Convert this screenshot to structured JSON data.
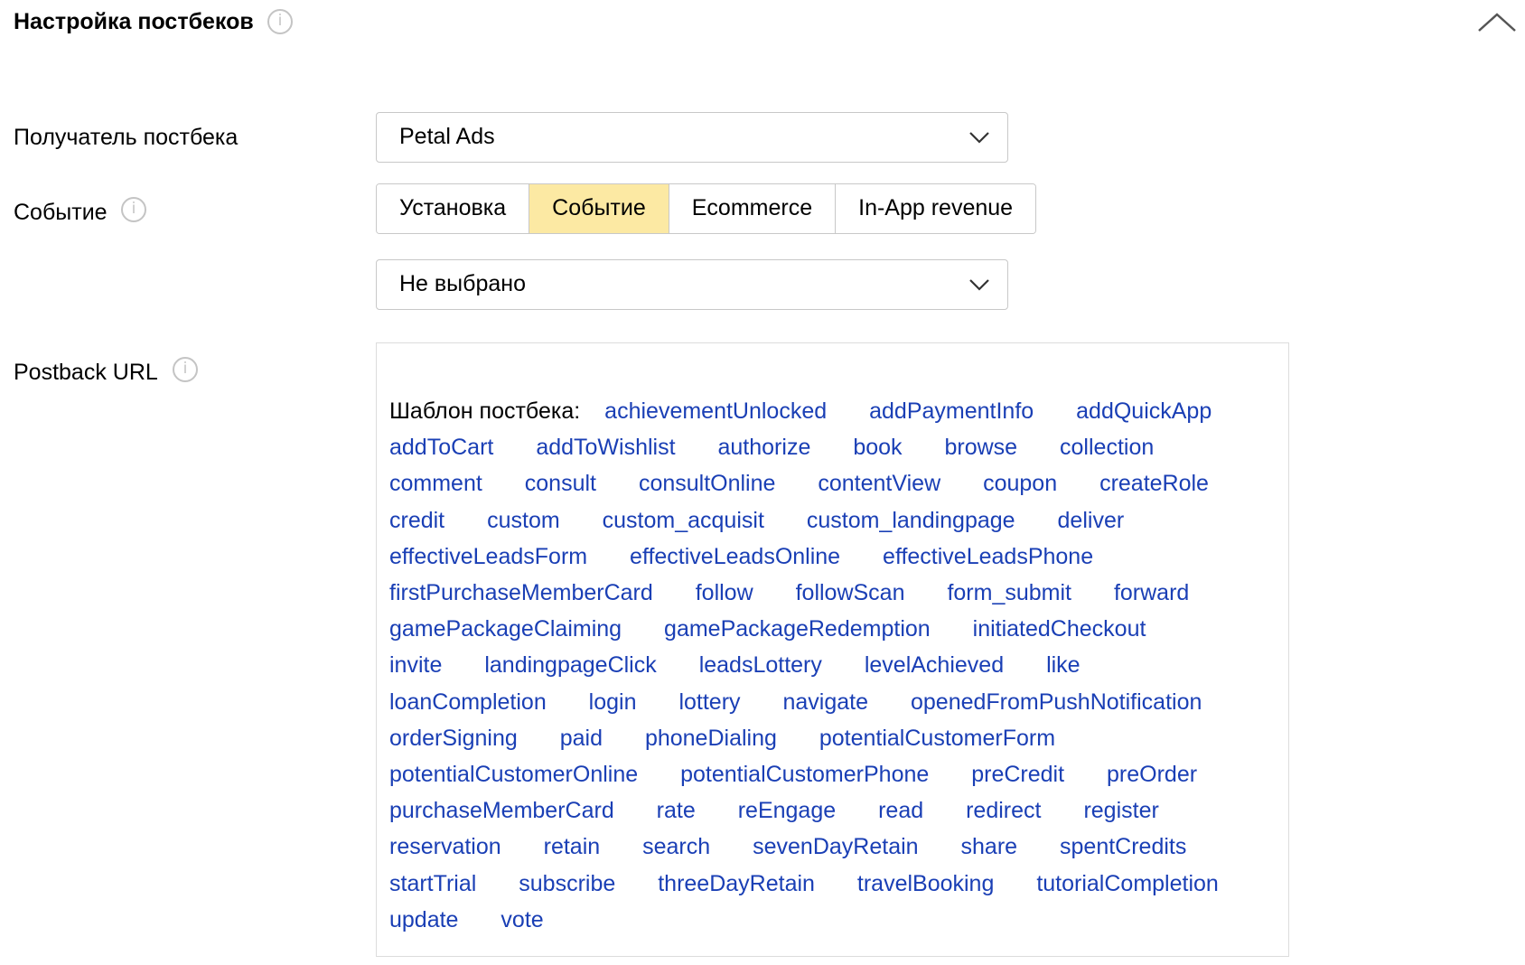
{
  "header": {
    "title": "Настройка постбеков"
  },
  "form": {
    "recipient": {
      "label": "Получатель постбека",
      "value": "Petal Ads"
    },
    "event": {
      "label": "Событие",
      "tabs": [
        "Установка",
        "Событие",
        "Ecommerce",
        "In-App revenue"
      ],
      "active_tab": "Событие",
      "select_value": "Не выбрано"
    },
    "postback_url": {
      "label": "Postback URL",
      "template_label": "Шаблон постбека:",
      "macros": [
        "achievementUnlocked",
        "addPaymentInfo",
        "addQuickApp",
        "addToCart",
        "addToWishlist",
        "authorize",
        "book",
        "browse",
        "collection",
        "comment",
        "consult",
        "consultOnline",
        "contentView",
        "coupon",
        "createRole",
        "credit",
        "custom",
        "custom_acquisit",
        "custom_landingpage",
        "deliver",
        "effectiveLeadsForm",
        "effectiveLeadsOnline",
        "effectiveLeadsPhone",
        "firstPurchaseMemberCard",
        "follow",
        "followScan",
        "form_submit",
        "forward",
        "gamePackageClaiming",
        "gamePackageRedemption",
        "initiatedCheckout",
        "invite",
        "landingpageClick",
        "leadsLottery",
        "levelAchieved",
        "like",
        "loanCompletion",
        "login",
        "lottery",
        "navigate",
        "openedFromPushNotification",
        "orderSigning",
        "paid",
        "phoneDialing",
        "potentialCustomerForm",
        "potentialCustomerOnline",
        "potentialCustomerPhone",
        "preCredit",
        "preOrder",
        "purchaseMemberCard",
        "rate",
        "reEngage",
        "read",
        "redirect",
        "register",
        "reservation",
        "retain",
        "search",
        "sevenDayRetain",
        "share",
        "spentCredits",
        "startTrial",
        "subscribe",
        "threeDayRetain",
        "travelBooking",
        "tutorialCompletion",
        "update",
        "vote"
      ]
    }
  },
  "colors": {
    "link": "#1a3fb5",
    "active_tab_bg": "#fce9a3",
    "border": "#c8c8c8",
    "info_icon": "#c4c4c4"
  },
  "icons": {
    "info": "info-icon",
    "collapse": "chevron-up-icon",
    "dropdown": "chevron-down-icon"
  }
}
